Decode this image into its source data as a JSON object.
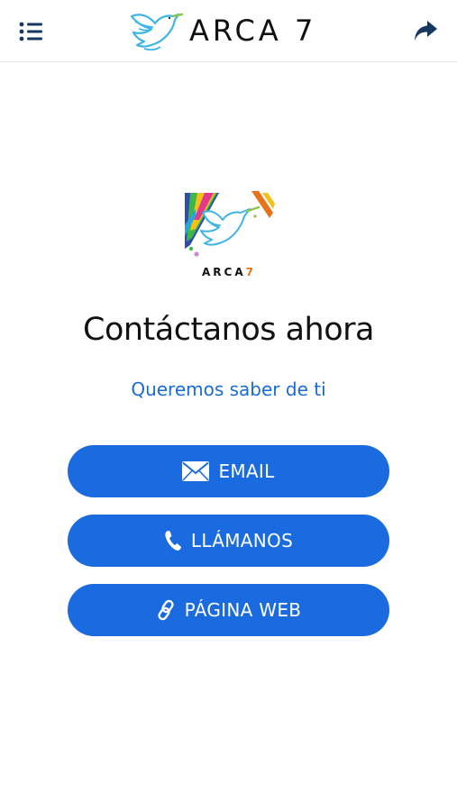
{
  "header": {
    "brand": "ARCA 7",
    "menu_icon": "menu-list-icon",
    "share_icon": "share-arrow-icon"
  },
  "logo": {
    "brand": "ARCA",
    "number": "7"
  },
  "main": {
    "title": "Contáctanos ahora",
    "subtitle": "Queremos saber de ti"
  },
  "actions": [
    {
      "label": "EMAIL",
      "icon": "envelope-icon"
    },
    {
      "label": "LLÁMANOS",
      "icon": "phone-icon"
    },
    {
      "label": "PÁGINA WEB",
      "icon": "link-icon"
    }
  ],
  "colors": {
    "accent": "#1a6ae0",
    "subtitle": "#1a6bd6",
    "header_icons": "#14385e",
    "logo_seven": "#e8731a"
  }
}
